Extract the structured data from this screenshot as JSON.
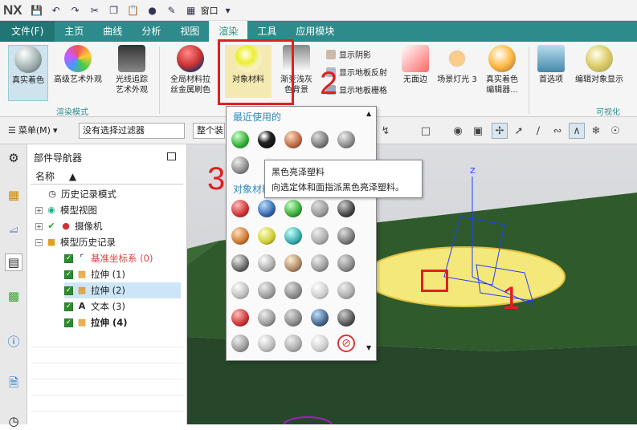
{
  "app": {
    "logo": "NX"
  },
  "qat": {
    "window_menu": "窗口"
  },
  "tabs": [
    "文件(F)",
    "主页",
    "曲线",
    "分析",
    "视图",
    "渲染",
    "工具",
    "应用模块"
  ],
  "ribbon": {
    "real_shading": "真实着色",
    "advanced_art": "高级艺术外观",
    "raytrace_art": [
      "光线追踪",
      "艺术外观"
    ],
    "global_material": [
      "全局材料拉",
      "丝金属刷色"
    ],
    "object_material": "对象材料",
    "gradient_bg": [
      "渐变浅灰",
      "色背景"
    ],
    "show_shadow": "显示阴影",
    "show_floor_reflect": "显示地板反射",
    "show_floor_grid": "显示地板栅格",
    "no_edge": "无面边",
    "scene_light": "场景灯光 3",
    "real_shading_editor": [
      "真实着色",
      "编辑器..."
    ],
    "preferences": "首选项",
    "edit_art_display": "编辑对象显示",
    "group_real_shading": "渲染模式",
    "group_visual": "可视化"
  },
  "toolbar": {
    "menu": "菜单(M)",
    "filter": "没有选择过滤器",
    "assembly": "整个装配"
  },
  "navigator": {
    "title": "部件导航器",
    "column_name": "名称",
    "items": [
      {
        "label": "历史记录模式"
      },
      {
        "label": "模型视图"
      },
      {
        "label": "摄像机"
      },
      {
        "label": "模型历史记录"
      },
      {
        "label": "基准坐标系 (0)"
      },
      {
        "label": "拉伸 (1)"
      },
      {
        "label": "拉伸 (2)"
      },
      {
        "label": "文本 (3)"
      },
      {
        "label": "拉伸 (4)"
      }
    ]
  },
  "palette": {
    "recent_title": "最近使用的",
    "object_title": "对象材料"
  },
  "tooltip": {
    "title": "黑色亮泽塑料",
    "desc": "向选定体和面指派黑色亮泽塑料。"
  },
  "annotations": {
    "n1": "1",
    "n2": "2",
    "n3": "3"
  },
  "colors": {
    "accent": "#2e8b8b",
    "annotation_red": "#e02020",
    "face_yellow": "#f5e87a",
    "model_green": "#2f5a2c"
  }
}
